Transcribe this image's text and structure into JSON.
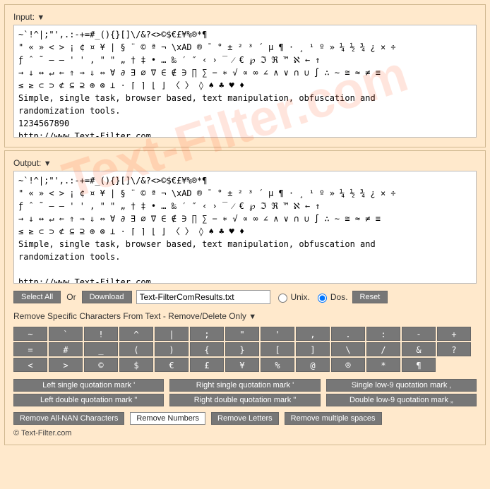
{
  "input": {
    "label": "Input:",
    "text": "~`!^|;\"',.:-+=#_(){}[]\\/&?<>©$€£¥%®*¶\n\" « » < > ¡ ¢ ¤ ¥ | § ¨ © ª ¬ \\xAD ® ¯ ° ± ² ³ ´ µ ¶ · ¸ ¹ º » ¼ ½ ¾ ¿ × ÷\nƒ ˆ ˜ – — ' ' ‚ \" \" „ † ‡ • … ‰ ′ ″ ‹ › ‾ ⁄ € ℘ ℑ ℜ ™ ℵ ← ↑\n→ ↓ ↔ ↵ ⇐ ⇑ ⇒ ⇓ ⇔ ∀ ∂ ∃ ∅ ∇ ∈ ∉ ∋ ∏ ∑ − ∗ √ ∝ ∞ ∠ ∧ ∨ ∩ ∪ ∫ ∴ ∼ ≅ ≈ ≠ ≡\n≤ ≥ ⊂ ⊃ ⊄ ⊆ ⊇ ⊕ ⊗ ⊥ ⋅ ⌈ ⌉ ⌊ ⌋ 〈 〉 ◊ ♠ ♣ ♥ ♦\nSimple, single task, browser based, text manipulation, obfuscation and\nrandomization tools.\n1234567890\nhttp://www.Text-Filter.com"
  },
  "output": {
    "label": "Output:",
    "text": "~`!^|;\"',.:-+=#_(){}[]\\/&?<>©$€£¥%®*¶\n\" « » < > ¡ ¢ ¤ ¥ | § ¨ © ª ¬ \\xAD ® ¯ ° ± ² ³ ´ µ ¶ · ¸ ¹ º » ¼ ½ ¾ ¿ × ÷\nƒ ˆ ˜ – — ' ' ‚ \" \" „ † ‡ • … ‰ ′ ″ ‹ › ‾ ⁄ € ℘ ℑ ℜ ™ ℵ ← ↑\n→ ↓ ↔ ↵ ⇐ ⇑ ⇒ ⇓ ⇔ ∀ ∂ ∃ ∅ ∇ ∈ ∉ ∋ ∏ ∑ − ∗ √ ∝ ∞ ∠ ∧ ∨ ∩ ∪ ∫ ∴ ∼ ≅ ≈ ≠ ≡\n≤ ≥ ⊂ ⊃ ⊄ ⊆ ⊇ ⊕ ⊗ ⊥ ⋅ ⌈ ⌉ ⌊ ⌋ 〈 〉 ◊ ♠ ♣ ♥ ♦\nSimple, single task, browser based, text manipulation, obfuscation and\nrandomization tools.\n\nhttp://www.Text-Filter.com"
  },
  "toolbar": {
    "select_all": "Select All",
    "or": "Or",
    "download": "Download",
    "filename": "Text-FilterComResults.txt",
    "unix": "Unix.",
    "dos": "Dos.",
    "reset": "Reset"
  },
  "section": {
    "title": "Remove Specific Characters From Text - Remove/Delete Only"
  },
  "char_buttons": [
    "~",
    "`",
    "!",
    "^",
    "|",
    ";",
    "\"",
    "'",
    ",",
    ".",
    ":",
    "-",
    "+",
    "=",
    "#",
    "_",
    "(",
    ")",
    "{",
    "}",
    "[",
    "]",
    "\\",
    "/",
    "&",
    "?",
    "<",
    ">",
    "©",
    "$",
    "€",
    "£",
    "¥",
    "%",
    "@",
    "®",
    "*",
    "¶"
  ],
  "quote_rows": [
    [
      "Left single quotation mark  '",
      "Right single quotation mark  '",
      "Single low-9 quotation mark ‚"
    ],
    [
      "Left double quotation mark \"",
      "Right double quotation mark \"",
      "Double low-9 quotation mark „"
    ]
  ],
  "actions": {
    "nan": "Remove All-NAN Characters",
    "numbers": "Remove Numbers",
    "letters": "Remove Letters",
    "spaces": "Remove multiple spaces"
  },
  "footer": "© Text-Filter.com"
}
